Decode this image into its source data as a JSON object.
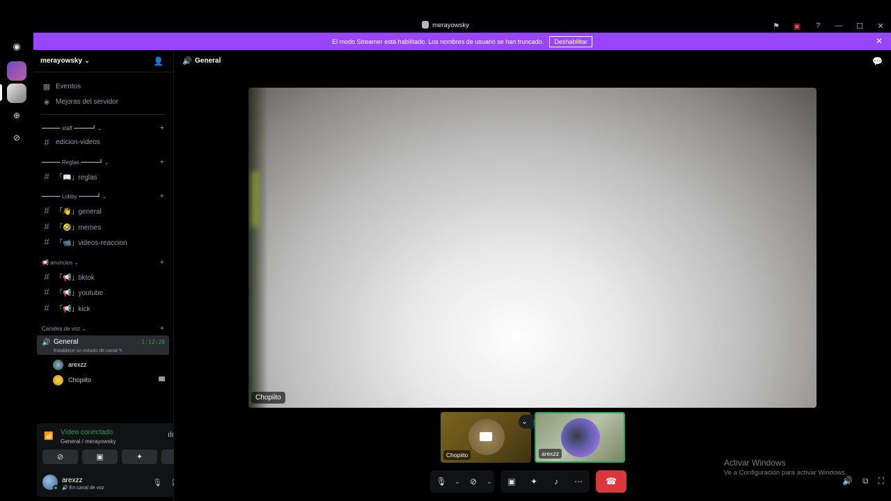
{
  "window": {
    "title": "merayowsky"
  },
  "banner": {
    "text": "El modo Streamer está habilitado. Los nombres de usuario se han truncado.",
    "button": "Deshabilitar"
  },
  "server": {
    "name": "merayowsky ⌄"
  },
  "sidebar": {
    "events": "Eventos",
    "boosts": "Mejoras del servidor",
    "categories": [
      {
        "label": "━━━━━╸staff╺━━━━━┛ ⌄"
      },
      {
        "label": "━━━━━╸Reglas╺━━━━━┛ ⌄"
      },
      {
        "label": "━━━━━╸Lobby╺━━━━━┛ ⌄"
      },
      {
        "label": "📢 anuncios ⌄"
      },
      {
        "label": "Canales de voz ⌄"
      }
    ],
    "channels": {
      "edicion": "edicion-videos",
      "reglas": "「📖」reglas",
      "general": "「👋」general",
      "memes": "「🤣」memes",
      "videos": "「📹」videos-reaccion",
      "tiktok": "「📢」tiktok",
      "youtube": "「📢」youtube",
      "kick": "「📢」kick"
    },
    "voice_channel": {
      "name": "General",
      "time": "1:12:20",
      "status": "Establece un estado de canal ✎"
    },
    "voice_users": [
      {
        "name": "arexzz"
      },
      {
        "name": "Chopiito"
      }
    ]
  },
  "voice_panel": {
    "status": "Vídeo conectado",
    "location": "General / merayowsky",
    "user": {
      "name": "arexzz",
      "state": "🔊 En canal de voz"
    }
  },
  "main": {
    "channel_name": "General",
    "stage_label": "Chopiito",
    "tile1_label": "Chopiito",
    "tile2_label": "arexzz"
  },
  "watermark": {
    "line1": "Activar Windows",
    "line2": "Ve a Configuración para activar Windows."
  },
  "colors": {
    "accent": "#9945ff",
    "online": "#23a55a",
    "danger": "#da373c"
  }
}
